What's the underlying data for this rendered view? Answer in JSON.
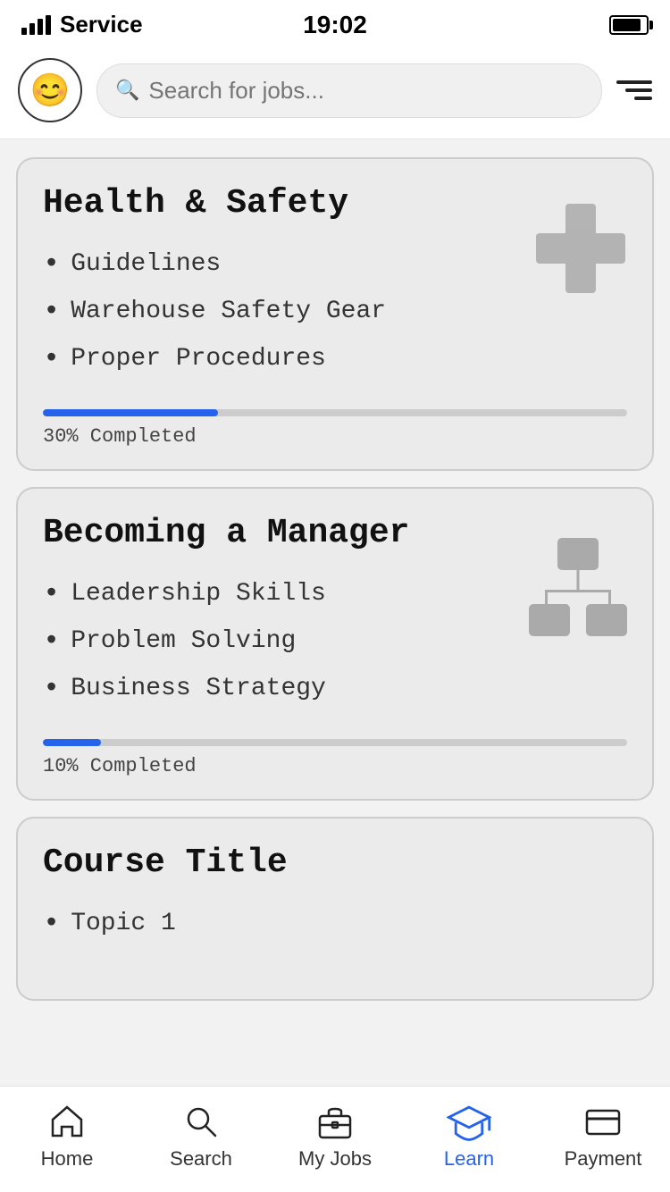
{
  "statusBar": {
    "carrier": "Service",
    "time": "19:02"
  },
  "header": {
    "searchPlaceholder": "Search for jobs...",
    "filterLabel": "filter"
  },
  "courses": [
    {
      "id": "health-safety",
      "title": "Health & Safety",
      "topics": [
        "Guidelines",
        "Warehouse Safety Gear",
        "Proper Procedures"
      ],
      "progress": 30,
      "progressLabel": "30% Completed",
      "icon": "cross"
    },
    {
      "id": "becoming-manager",
      "title": "Becoming a Manager",
      "topics": [
        "Leadership Skills",
        "Problem Solving",
        "Business Strategy"
      ],
      "progress": 10,
      "progressLabel": "10% Completed",
      "icon": "org-chart"
    },
    {
      "id": "course-title",
      "title": "Course Title",
      "topics": [
        "Topic 1"
      ],
      "progress": 0,
      "progressLabel": "",
      "icon": "none"
    }
  ],
  "bottomNav": [
    {
      "id": "home",
      "label": "Home",
      "active": false
    },
    {
      "id": "search",
      "label": "Search",
      "active": false
    },
    {
      "id": "my-jobs",
      "label": "My Jobs",
      "active": false
    },
    {
      "id": "learn",
      "label": "Learn",
      "active": true
    },
    {
      "id": "payment",
      "label": "Payment",
      "active": false
    }
  ]
}
